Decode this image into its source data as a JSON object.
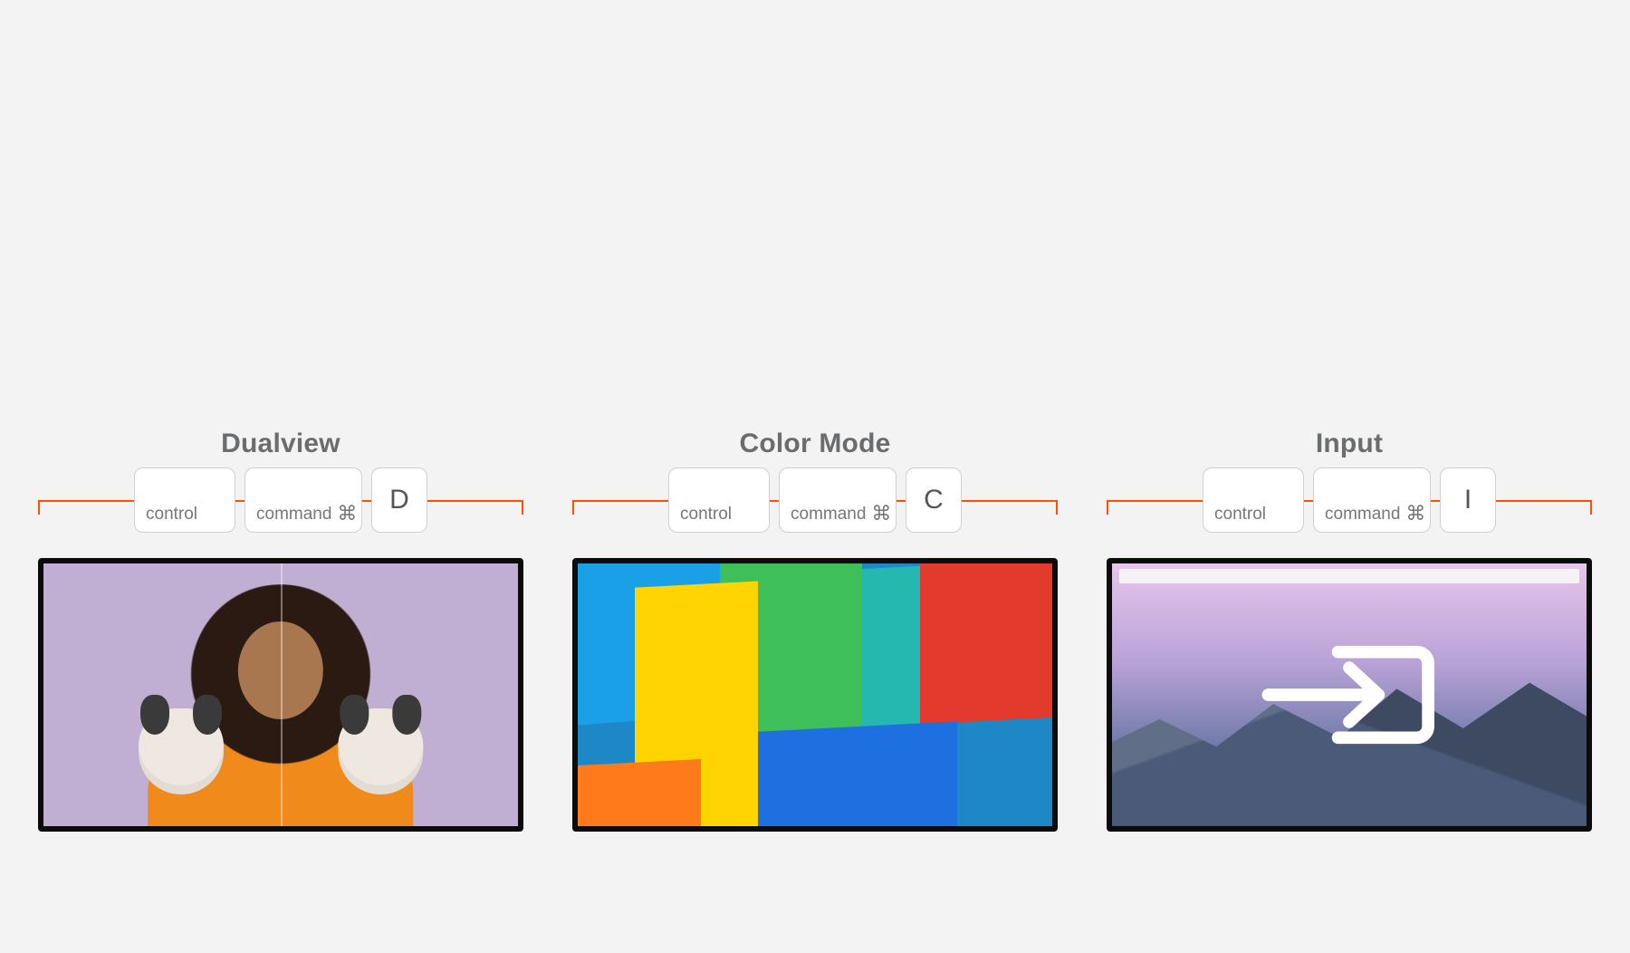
{
  "panels": [
    {
      "title": "Dualview",
      "keys": {
        "mod1": "control",
        "mod2": "command",
        "cmd_symbol": "⌘",
        "letter": "D"
      }
    },
    {
      "title": "Color Mode",
      "keys": {
        "mod1": "control",
        "mod2": "command",
        "cmd_symbol": "⌘",
        "letter": "C"
      }
    },
    {
      "title": "Input",
      "keys": {
        "mod1": "control",
        "mod2": "command",
        "cmd_symbol": "⌘",
        "letter": "I"
      }
    }
  ]
}
